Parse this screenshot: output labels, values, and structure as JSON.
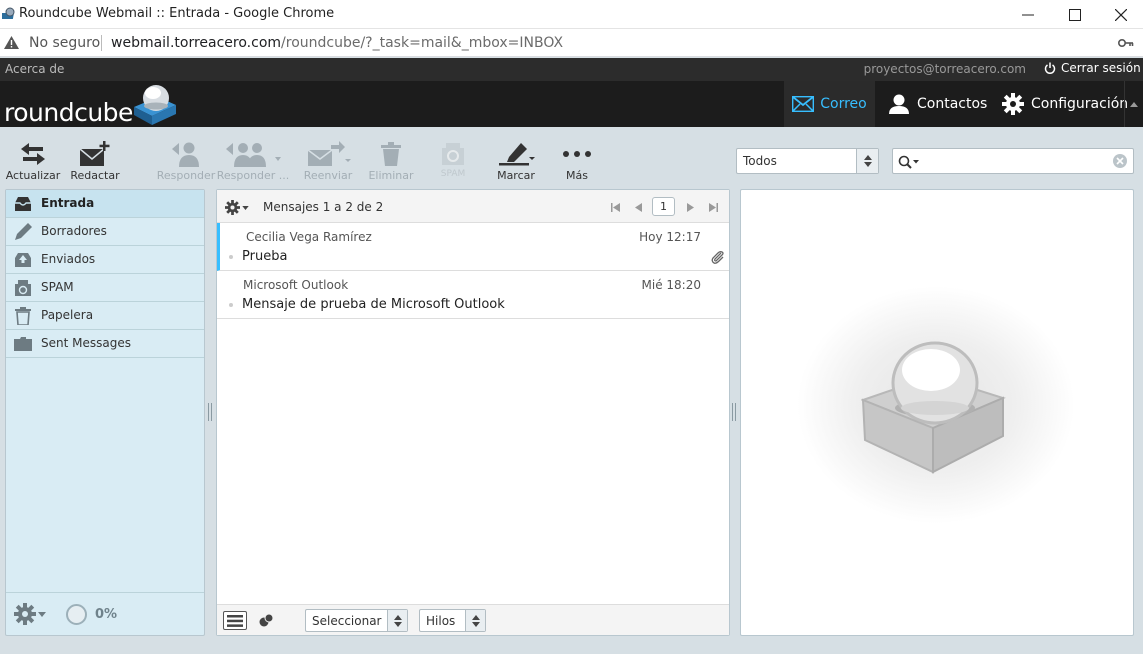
{
  "window": {
    "title": "Roundcube Webmail :: Entrada - Google Chrome"
  },
  "addressbar": {
    "security": "No seguro",
    "url_host": "webmail.torreacero.com",
    "url_path": "/roundcube/?_task=mail&_mbox=INBOX"
  },
  "topline": {
    "about": "Acerca de",
    "username": "proyectos@torreacero.com",
    "logout": "Cerrar sesión"
  },
  "brand": {
    "logo_text": "roundcube"
  },
  "nav": {
    "mail": "Correo",
    "contacts": "Contactos",
    "settings": "Configuración"
  },
  "toolbar": {
    "refresh": "Actualizar",
    "compose": "Redactar",
    "reply": "Responder",
    "reply_all": "Responder ...",
    "forward": "Reenviar",
    "delete": "Eliminar",
    "spam": "SPAM",
    "mark": "Marcar",
    "more": "Más"
  },
  "filter": {
    "selected": "Todos"
  },
  "search": {
    "placeholder": ""
  },
  "folders": [
    {
      "name": "Entrada",
      "icon": "inbox-icon",
      "active": true
    },
    {
      "name": "Borradores",
      "icon": "pencil-icon"
    },
    {
      "name": "Enviados",
      "icon": "sent-icon"
    },
    {
      "name": "SPAM",
      "icon": "spam-icon"
    },
    {
      "name": "Papelera",
      "icon": "trash-icon"
    },
    {
      "name": "Sent Messages",
      "icon": "folder-icon"
    }
  ],
  "quota": {
    "value": "0%"
  },
  "messagelist": {
    "count_text": "Mensajes 1 a 2 de 2",
    "page": "1",
    "messages": [
      {
        "from": "Cecilia Vega Ramírez",
        "date": "Hoy 12:17",
        "subject": "Prueba",
        "attachment": true
      },
      {
        "from": "Microsoft Outlook",
        "date": "Mié 18:20",
        "subject": "Mensaje de prueba de Microsoft Outlook",
        "attachment": false
      }
    ],
    "select_label": "Seleccionar",
    "threads_label": "Hilos"
  },
  "colors": {
    "accent": "#37beff",
    "header_bg": "#1c1c1c",
    "folder_bg": "#d9ecf4",
    "app_bg": "#d6dfe4"
  }
}
